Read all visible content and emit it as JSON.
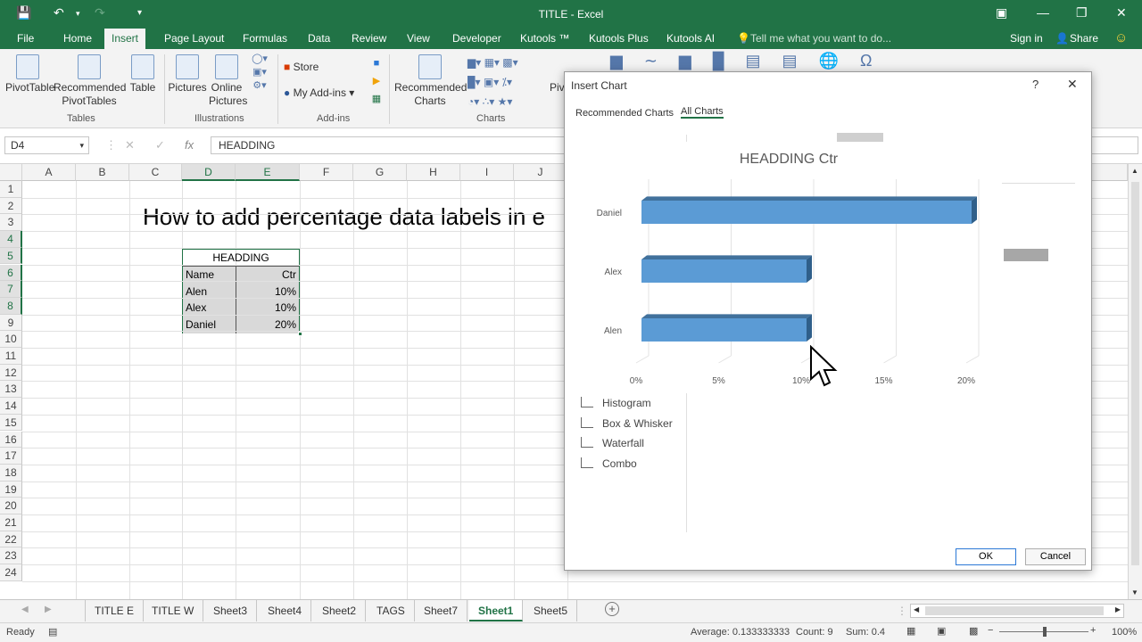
{
  "window": {
    "title": "TITLE - Excel",
    "signin": "Sign in",
    "share": "Share",
    "tell_me": "Tell me what you want to do..."
  },
  "ribbon_tabs": [
    "File",
    "Home",
    "Insert",
    "Page Layout",
    "Formulas",
    "Data",
    "Review",
    "View",
    "Developer",
    "Kutools ™",
    "Kutools Plus",
    "Kutools AI"
  ],
  "ribbon": {
    "pivot_table": "PivotTable",
    "recommended_pivot_1": "Recommended",
    "recommended_pivot_2": "PivotTables",
    "table": "Table",
    "pictures": "Pictures",
    "online_1": "Online",
    "online_2": "Pictures",
    "store": "Store",
    "my_addins": "My Add-ins",
    "rec_charts_1": "Recommended",
    "rec_charts_2": "Charts",
    "group_tables": "Tables",
    "group_illustrations": "Illustrations",
    "group_addins": "Add-ins",
    "group_charts": "Charts",
    "pivot_chart_partial": "Piv"
  },
  "formula_bar": {
    "name_box": "D4",
    "fx": "fx",
    "value": "HEADDING"
  },
  "columns": [
    "A",
    "B",
    "C",
    "D",
    "E",
    "F",
    "G",
    "H",
    "I",
    "J"
  ],
  "rows": [
    "1",
    "2",
    "3",
    "4",
    "5",
    "6",
    "7",
    "8",
    "9",
    "10",
    "11",
    "12",
    "13",
    "14",
    "15",
    "16",
    "17",
    "18",
    "19",
    "20",
    "21",
    "22",
    "23",
    "24"
  ],
  "sheet": {
    "big_title": "How to add percentage data labels in e",
    "table_heading": "HEADDING",
    "header_name": "Name",
    "header_ctr": "Ctr",
    "rows": [
      {
        "name": "Alen",
        "ctr": "10%"
      },
      {
        "name": "Alex",
        "ctr": "10%"
      },
      {
        "name": "Daniel",
        "ctr": "20%"
      }
    ]
  },
  "sheet_tabs": [
    "TITLE E",
    "TITLE W",
    "Sheet3",
    "Sheet4",
    "Sheet2",
    "TAGS",
    "Sheet7",
    "Sheet1",
    "Sheet5"
  ],
  "active_sheet": "Sheet1",
  "status": {
    "ready": "Ready",
    "average": "Average: 0.133333333",
    "count": "Count: 9",
    "sum": "Sum: 0.4",
    "zoom": "100%"
  },
  "dialog": {
    "title": "Insert Chart",
    "help": "?",
    "tab_recommended": "Recommended Charts",
    "tab_all": "All Charts",
    "chart_types": [
      "Histogram",
      "Box & Whisker",
      "Waterfall",
      "Combo"
    ],
    "ok": "OK",
    "cancel": "Cancel"
  },
  "chart_data": {
    "type": "bar",
    "title": "HEADDING Ctr",
    "categories": [
      "Daniel",
      "Alex",
      "Alen"
    ],
    "values": [
      0.2,
      0.1,
      0.1
    ],
    "x_ticks": [
      "0%",
      "5%",
      "10%",
      "15%",
      "20%"
    ],
    "xlim": [
      0,
      0.2
    ],
    "grid": true,
    "bar_color": "#5b9bd5"
  }
}
